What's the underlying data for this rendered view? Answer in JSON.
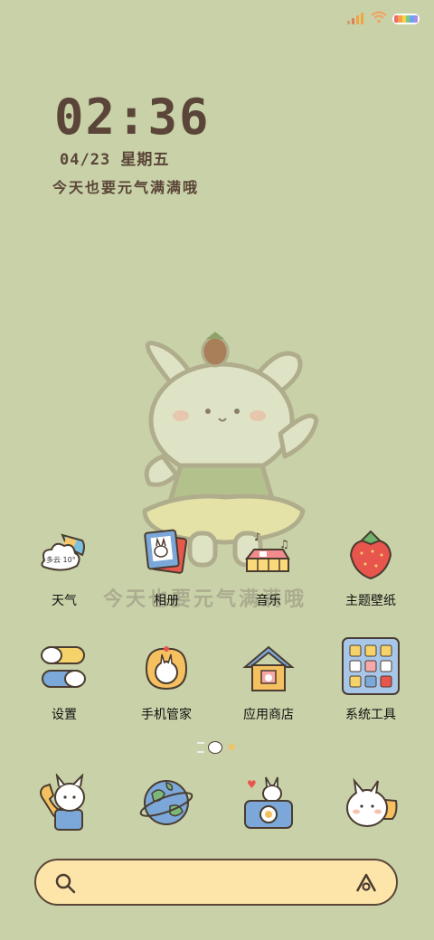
{
  "clock": {
    "time": "02:36",
    "date": "04/23  星期五",
    "motto": "今天也要元气满满哦"
  },
  "watermark": "今天也要元气满满哦",
  "status": {
    "battery_colors": [
      "#f26b6b",
      "#f6a24b",
      "#f3d34a",
      "#7cc98a",
      "#6ba7e8",
      "#a98be8"
    ]
  },
  "weather_widget": {
    "text": "多云 10°"
  },
  "apps_row1": [
    {
      "label": "天气",
      "icon": "weather-icon"
    },
    {
      "label": "相册",
      "icon": "photo-album-icon"
    },
    {
      "label": "音乐",
      "icon": "music-piano-icon"
    },
    {
      "label": "主题壁纸",
      "icon": "strawberry-theme-icon"
    }
  ],
  "apps_row2": [
    {
      "label": "设置",
      "icon": "settings-toggle-icon"
    },
    {
      "label": "手机管家",
      "icon": "phone-manager-icon"
    },
    {
      "label": "应用商店",
      "icon": "app-store-house-icon"
    },
    {
      "label": "系统工具",
      "icon": "system-tools-icon"
    }
  ],
  "dock": [
    {
      "icon": "phone-call-icon"
    },
    {
      "icon": "browser-globe-icon"
    },
    {
      "icon": "camera-icon"
    },
    {
      "icon": "messages-icon"
    }
  ],
  "search": {
    "left_icon": "search-icon",
    "right_icon": "assistant-icon"
  },
  "page_indicator": {
    "pages": 3,
    "current": 2
  }
}
